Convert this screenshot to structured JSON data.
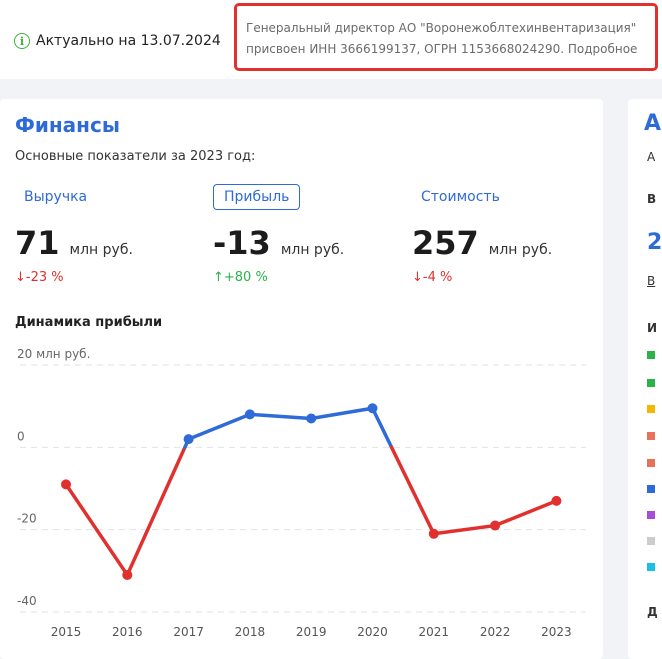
{
  "header": {
    "actual_label": "Актуально на 13.07.2024",
    "notice_line1": "Генеральный директор АО \"Воронежоблтехинвентаризация\"",
    "notice_line2": "присвоен ИНН 3666199137, ОГРН 1153668024290. Подробное"
  },
  "finance": {
    "title": "Финансы",
    "subtitle": "Основные показатели за 2023 год:",
    "metrics": [
      {
        "label": "Выручка",
        "value": "71",
        "unit": "млн руб.",
        "change": "↓-23 %",
        "trend": "down"
      },
      {
        "label": "Прибыль",
        "value": "-13",
        "unit": "млн руб.",
        "change": "↑+80 %",
        "trend": "up"
      },
      {
        "label": "Стоимость",
        "value": "257",
        "unit": "млн руб.",
        "change": "↓-4 %",
        "trend": "down"
      }
    ],
    "active_metric": "Прибыль",
    "dynamics_title": "Динамика прибыли"
  },
  "side_card": {
    "title": "А",
    "lines": [
      "А",
      "В",
      "2",
      "В",
      "И",
      "Д"
    ]
  },
  "colors": {
    "accent": "#2f6bd8",
    "negative": "#e0312f",
    "positive": "#2bb34a",
    "legend": [
      "#2bb34a",
      "#2bb34a",
      "#f2b700",
      "#e8715a",
      "#e8715a",
      "#2f6bd8",
      "#a64ddb",
      "#cccccc",
      "#18c0e8"
    ]
  },
  "chart_data": {
    "type": "line",
    "title": "Динамика прибыли",
    "x": [
      "2015",
      "2016",
      "2017",
      "2018",
      "2019",
      "2020",
      "2021",
      "2022",
      "2023"
    ],
    "series": [
      {
        "values": [
          -9,
          -31,
          2,
          8,
          7,
          9.5,
          -21,
          -19,
          -13
        ]
      }
    ],
    "y_tick_labels": [
      "20 млн руб.",
      "0",
      "-20",
      "-40"
    ],
    "y_ticks": [
      20,
      0,
      -20,
      -40
    ],
    "ylim": [
      -40,
      20
    ],
    "grid": true,
    "positive_color": "#2f6bd8",
    "negative_color": "#e0312f"
  }
}
